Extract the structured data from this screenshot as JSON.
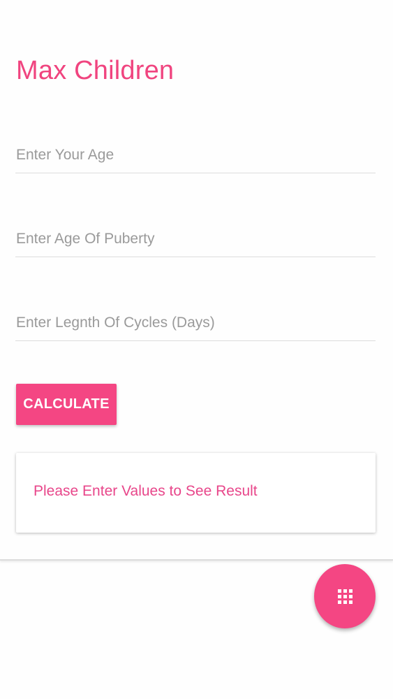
{
  "app": {
    "title": "Max Children"
  },
  "form": {
    "age_placeholder": "Enter Your Age",
    "puberty_placeholder": "Enter Age Of Puberty",
    "cycles_placeholder": "Enter Legnth Of Cycles (Days)",
    "calculate_label": "CALCULATE"
  },
  "result": {
    "message": "Please Enter Values to See Result"
  },
  "fab": {
    "icon": "grid-icon"
  },
  "colors": {
    "accent": "#f44683",
    "title": "#f0447f",
    "result_text": "#e8468a"
  }
}
